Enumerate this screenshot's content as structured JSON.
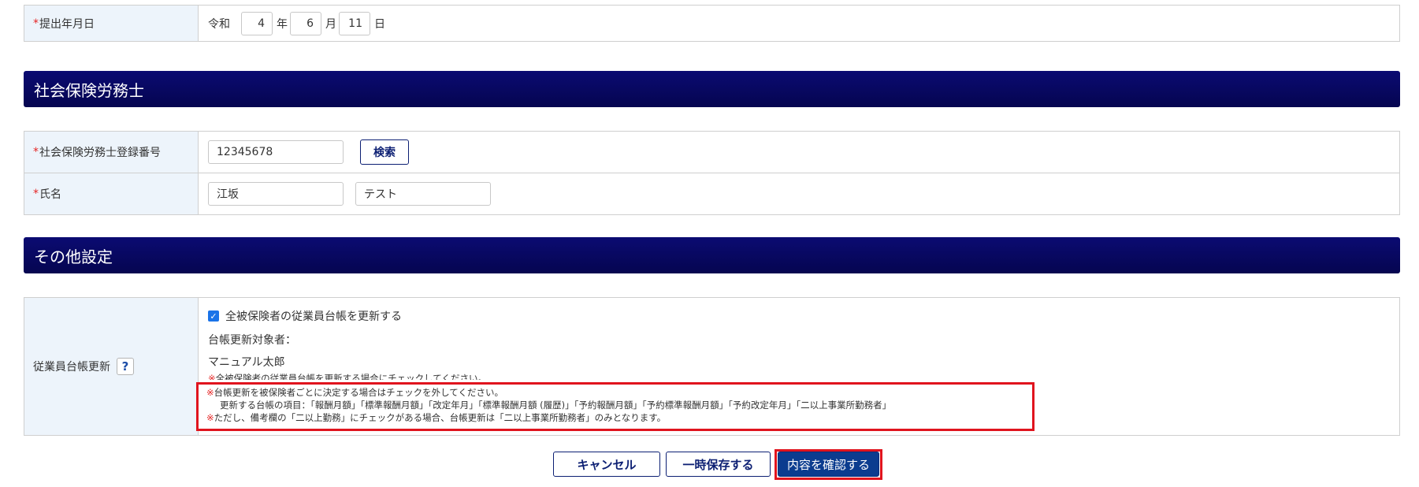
{
  "submission": {
    "label": "提出年月日",
    "era": "令和",
    "year": "4",
    "year_unit": "年",
    "month": "6",
    "month_unit": "月",
    "day": "11",
    "day_unit": "日"
  },
  "sharoushi_section": {
    "title": "社会保険労務士",
    "reg_label": "社会保険労務士登録番号",
    "reg_number": "12345678",
    "search_label": "検索",
    "name_label": "氏名",
    "last_name": "江坂",
    "first_name": "テスト"
  },
  "other_section": {
    "title": "その他設定",
    "ledger_label": "従業員台帳更新",
    "help_symbol": "?",
    "checkbox_label": "全被保険者の従業員台帳を更新する",
    "target_label": "台帳更新対象者：",
    "target_name": "マニュアル太郎",
    "note_mark": "※",
    "note1": "全被保険者の従業員台帳を更新する場合にチェックしてください。",
    "note2": "台帳更新を被保険者ごとに決定する場合はチェックを外してください。",
    "note3": "更新する台帳の項目：「報酬月額」「標準報酬月額」「改定年月」「標準報酬月額 (履歴)」「予約報酬月額」「予約標準報酬月額」「予約改定年月」「二以上事業所勤務者」",
    "note4": "ただし、備考欄の「二以上勤務」にチェックがある場合、台帳更新は「二以上事業所勤務者」のみとなります。"
  },
  "footer": {
    "cancel_label": "キャンセル",
    "save_label": "一時保存する",
    "confirm_label": "内容を確認する"
  },
  "colors": {
    "section_header": "#05055a",
    "label_bg": "#edf4fb",
    "required_mark": "#e52525",
    "highlight_border": "#e0141e",
    "primary_button": "#0b3c8f"
  }
}
